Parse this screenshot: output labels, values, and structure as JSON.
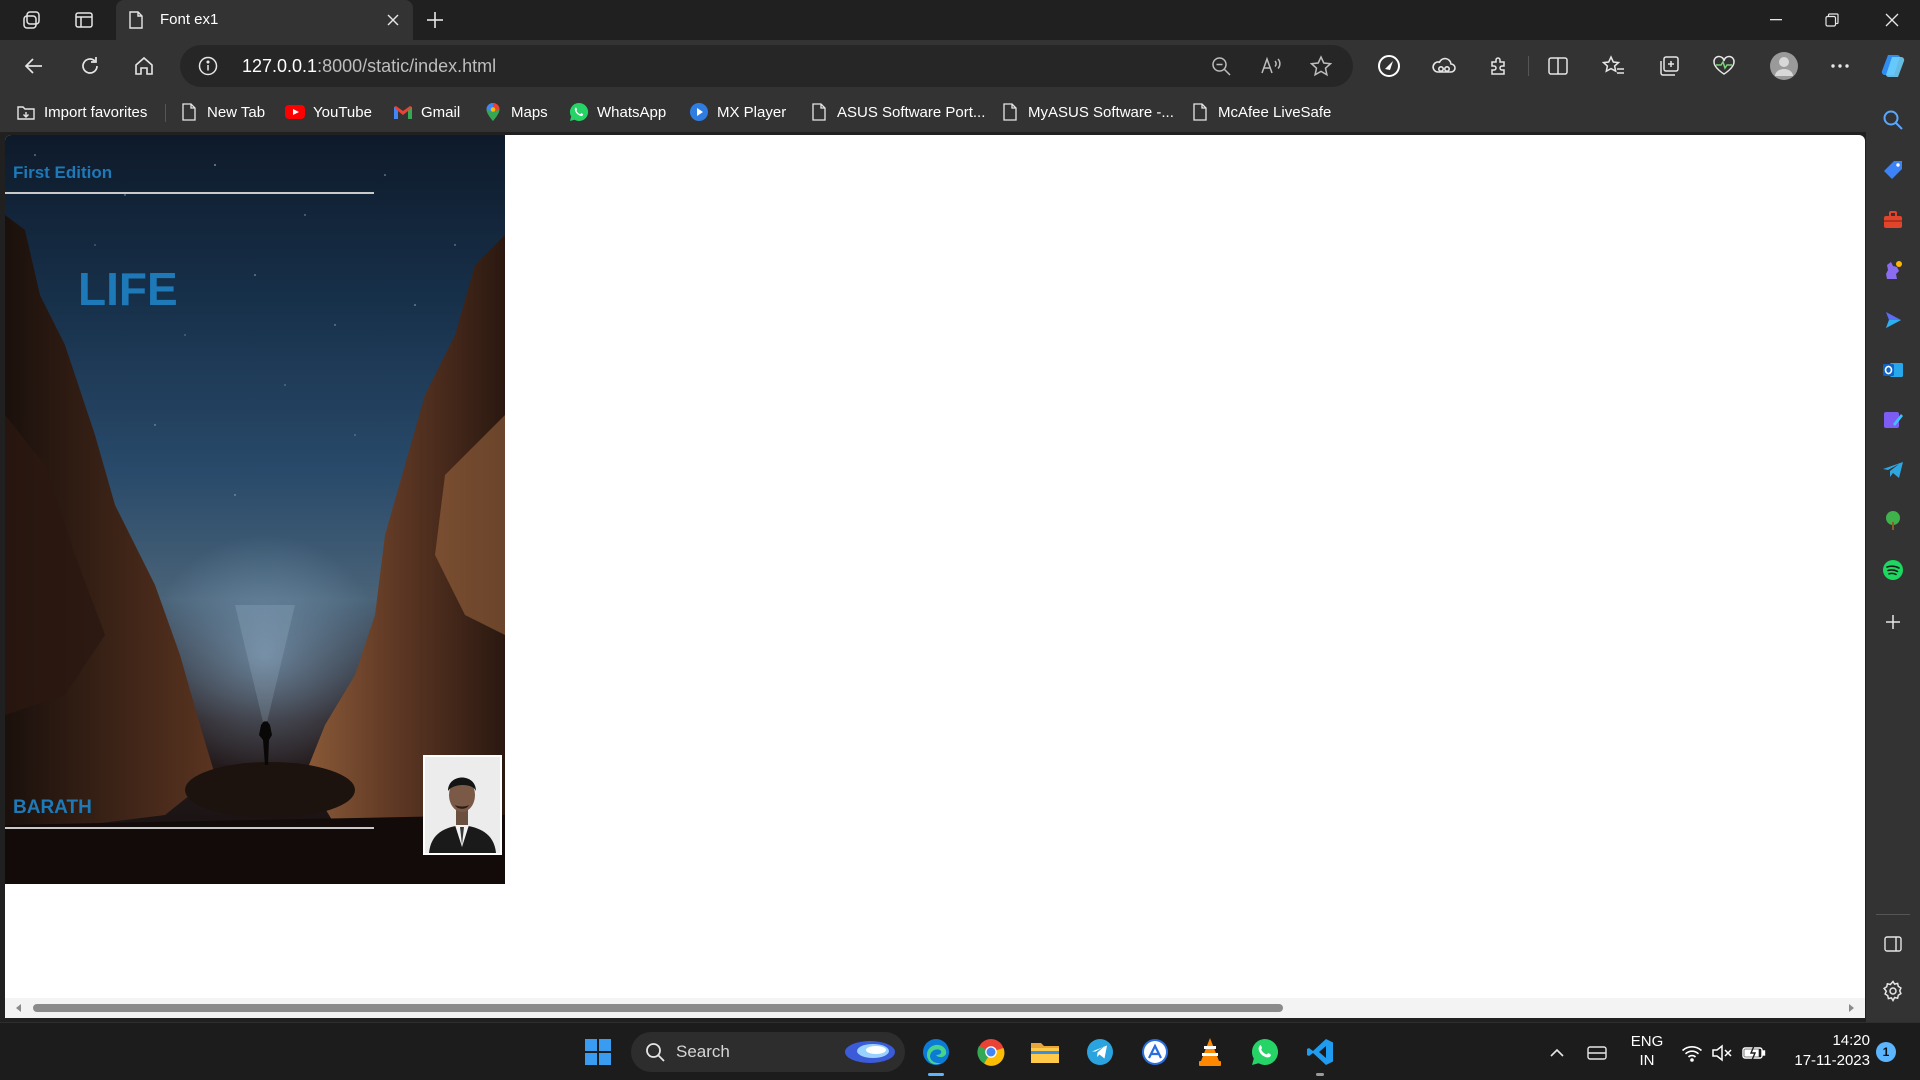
{
  "browser": {
    "tab_title": "Font ex1",
    "url_host": "127.0.0.1",
    "url_path": ":8000/static/index.html"
  },
  "bookmarks": [
    {
      "label": "Import favorites",
      "icon": "import-icon"
    },
    {
      "label": "New Tab",
      "icon": "page-icon"
    },
    {
      "label": "YouTube",
      "icon": "youtube-icon"
    },
    {
      "label": "Gmail",
      "icon": "gmail-icon"
    },
    {
      "label": "Maps",
      "icon": "maps-icon"
    },
    {
      "label": "WhatsApp",
      "icon": "whatsapp-icon"
    },
    {
      "label": "MX Player",
      "icon": "mxplayer-icon"
    },
    {
      "label": "ASUS Software Port...",
      "icon": "page-icon"
    },
    {
      "label": "MyASUS Software -...",
      "icon": "page-icon"
    },
    {
      "label": "McAfee LiveSafe",
      "icon": "page-icon"
    }
  ],
  "page": {
    "edition": "First Edition",
    "title": "LIFE",
    "author": "BARATH",
    "accent_color": "#1d79b8"
  },
  "taskbar": {
    "search_label": "Search",
    "language": "ENG",
    "region": "IN",
    "time": "14:20",
    "date": "17-11-2023",
    "notification_count": "1"
  }
}
